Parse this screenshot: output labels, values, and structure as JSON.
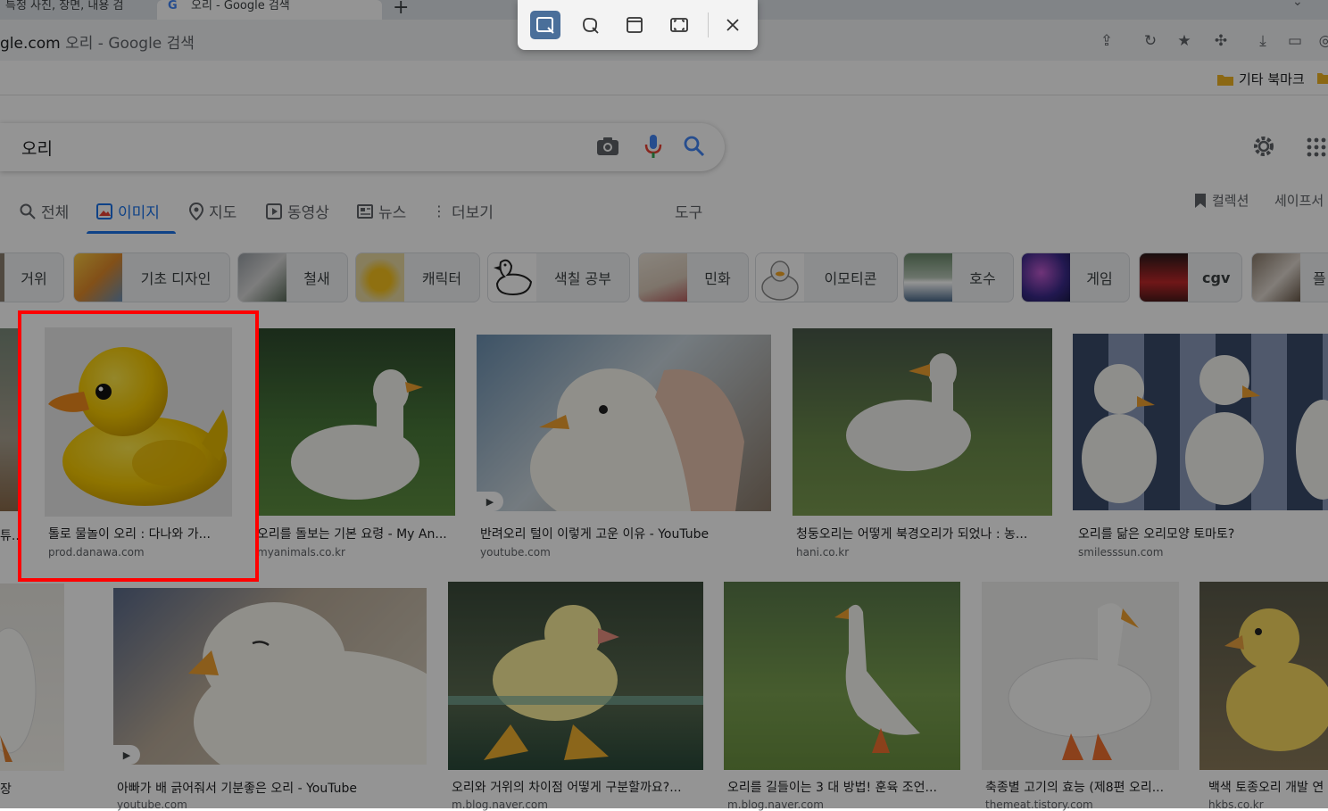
{
  "browser": {
    "tabs": [
      {
        "label": "특정 사진, 장면, 내용 검"
      },
      {
        "label": "오리 - Google 검색"
      }
    ],
    "new_tab": "+",
    "url_domain": "gle.com",
    "url_rest": "오리 - Google 검색",
    "bookmark_folder": "기타 북마크"
  },
  "search": {
    "query": "오리"
  },
  "nav_tabs": [
    {
      "label": "전체"
    },
    {
      "label": "이미지"
    },
    {
      "label": "지도"
    },
    {
      "label": "동영상"
    },
    {
      "label": "뉴스"
    },
    {
      "label": "더보기"
    }
  ],
  "tools_label": "도구",
  "collections_label": "컬렉션",
  "safesearch_label": "세이프서",
  "chips": [
    {
      "label": "거위"
    },
    {
      "label": "기초 디자인"
    },
    {
      "label": "철새"
    },
    {
      "label": "캐릭터"
    },
    {
      "label": "색칠 공부"
    },
    {
      "label": "민화"
    },
    {
      "label": "이모티콘"
    },
    {
      "label": "호수"
    },
    {
      "label": "게임"
    },
    {
      "label": "cgv"
    },
    {
      "label": "플"
    }
  ],
  "results_row1": [
    {
      "title": "튜...",
      "source": ""
    },
    {
      "title": "톨로 물놀이 오리 : 다나와 가...",
      "source": "prod.danawa.com"
    },
    {
      "title": "오리를 돌보는 기본 요령 - My An...",
      "source": "myanimals.co.kr"
    },
    {
      "title": "반려오리 털이 이렇게 고운 이유 - YouTube",
      "source": "youtube.com"
    },
    {
      "title": "청둥오리는 어떻게 북경오리가 되었나 : 농...",
      "source": "hani.co.kr"
    },
    {
      "title": "오리를 닮은 오리모양 토마토?",
      "source": "smilesssun.com"
    }
  ],
  "results_row2": [
    {
      "title": "장",
      "source": ""
    },
    {
      "title": "아빠가 배 긁어줘서 기분좋은 오리 - YouTube",
      "source": "youtube.com"
    },
    {
      "title": "오리와 거위의 차이점 어떻게 구분할까요?...",
      "source": "m.blog.naver.com"
    },
    {
      "title": "오리를 길들이는 3 대 방법! 훈육 조언...",
      "source": "m.blog.naver.com"
    },
    {
      "title": "축종별 고기의 효능 (제8편 오리...",
      "source": "themeat.tistory.com"
    },
    {
      "title": "백색 토종오리 개발 연",
      "source": "hkbs.co.kr"
    }
  ],
  "colors": {
    "accent": "#1a73e8",
    "highlight": "#ff0000",
    "overlay": "rgba(0,0,0,0.42)",
    "capture_selected": "#4a6f9a"
  }
}
